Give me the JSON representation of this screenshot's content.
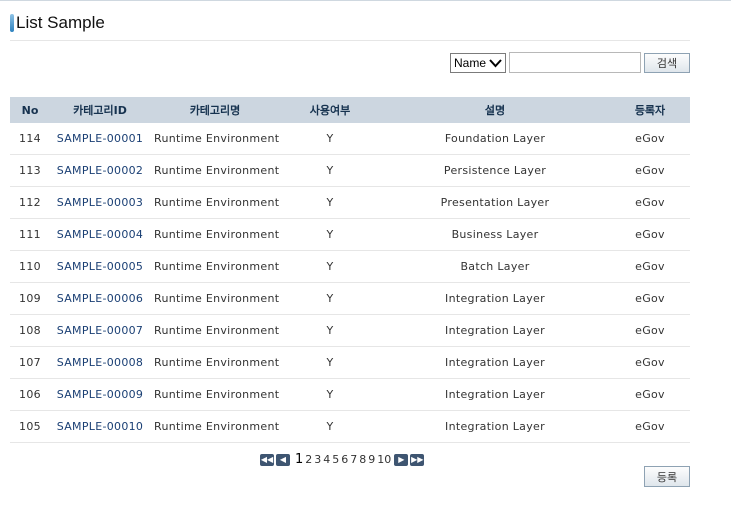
{
  "page": {
    "title": "List Sample"
  },
  "search": {
    "select_value": "Name",
    "input_value": "",
    "search_label": "검색"
  },
  "table": {
    "headers": [
      "No",
      "카테고리ID",
      "카테고리명",
      "사용여부",
      "설명",
      "등록자"
    ],
    "rows": [
      [
        "114",
        "SAMPLE-00001",
        "Runtime Environment",
        "Y",
        "Foundation Layer",
        "eGov"
      ],
      [
        "113",
        "SAMPLE-00002",
        "Runtime Environment",
        "Y",
        "Persistence Layer",
        "eGov"
      ],
      [
        "112",
        "SAMPLE-00003",
        "Runtime Environment",
        "Y",
        "Presentation Layer",
        "eGov"
      ],
      [
        "111",
        "SAMPLE-00004",
        "Runtime Environment",
        "Y",
        "Business Layer",
        "eGov"
      ],
      [
        "110",
        "SAMPLE-00005",
        "Runtime Environment",
        "Y",
        "Batch Layer",
        "eGov"
      ],
      [
        "109",
        "SAMPLE-00006",
        "Runtime Environment",
        "Y",
        "Integration Layer",
        "eGov"
      ],
      [
        "108",
        "SAMPLE-00007",
        "Runtime Environment",
        "Y",
        "Integration Layer",
        "eGov"
      ],
      [
        "107",
        "SAMPLE-00008",
        "Runtime Environment",
        "Y",
        "Integration Layer",
        "eGov"
      ],
      [
        "106",
        "SAMPLE-00009",
        "Runtime Environment",
        "Y",
        "Integration Layer",
        "eGov"
      ],
      [
        "105",
        "SAMPLE-00010",
        "Runtime Environment",
        "Y",
        "Integration Layer",
        "eGov"
      ]
    ]
  },
  "pagination": {
    "current": "1",
    "pages": [
      "1",
      "2",
      "3",
      "4",
      "5",
      "6",
      "7",
      "8",
      "9",
      "10"
    ]
  },
  "actions": {
    "register_label": "등록"
  },
  "icons": {
    "first": "double-chevron-left-icon",
    "prev": "chevron-left-icon",
    "next": "chevron-right-icon",
    "last": "double-chevron-right-icon"
  },
  "colors": {
    "header_bg": "#ccd6e0",
    "link": "#1a3f74",
    "pager_button": "#3e5571"
  }
}
